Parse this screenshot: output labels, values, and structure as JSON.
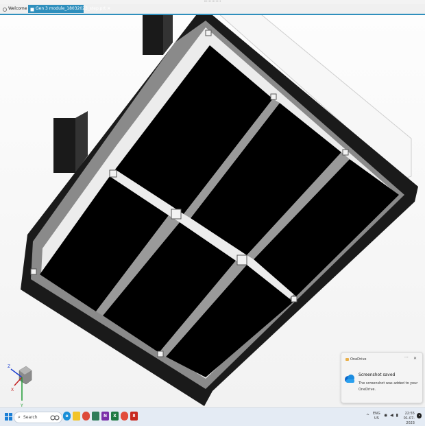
{
  "tabs": [
    {
      "label": "Welcome Page",
      "active": false
    },
    {
      "label": "Gen 3 module_18032023_step.prt",
      "active": true
    }
  ],
  "tab_close_glyph": "×",
  "viewport": {
    "model": "black panel module assembly (2x3 cells)"
  },
  "triad": {
    "z": "Z",
    "x": "X",
    "y": "Y"
  },
  "toast": {
    "app_name": "OneDrive",
    "more_glyph": "···",
    "close_glyph": "✕",
    "title": "Screenshot saved",
    "body": "The screenshot was added to your OneDrive."
  },
  "taskbar": {
    "search_placeholder": "Search",
    "pinned_icons": [
      "edge-icon",
      "file-explorer-icon",
      "chrome-icon",
      "app-icon",
      "onenote-icon",
      "excel-icon",
      "app-icon-2",
      "app-icon-3",
      "app-icon-4"
    ],
    "tray": {
      "chevron": "^",
      "lang_line1": "ENG",
      "lang_line2": "US",
      "time": "22:55",
      "date": "01-07-2023"
    }
  },
  "colors": {
    "accent": "#2f8fbd",
    "panel": "#000000",
    "frame": "#8c8c8c",
    "windows_blue": "#1b7fd6"
  }
}
